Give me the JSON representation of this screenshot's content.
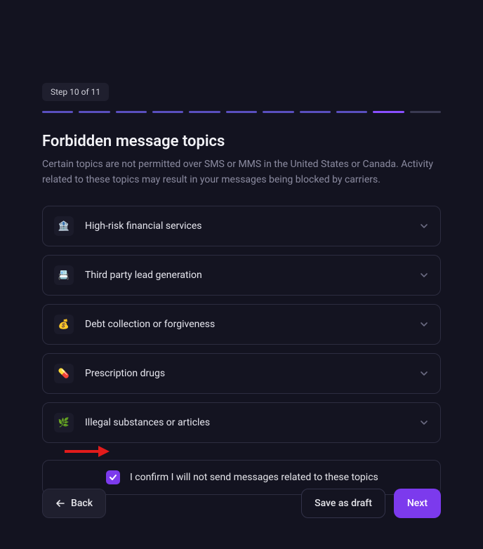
{
  "step": {
    "label": "Step 10 of 11",
    "segments": 11,
    "doneThrough": 9,
    "activeIndex": 10
  },
  "title": "Forbidden message topics",
  "subtitle": "Certain topics are not permitted over SMS or MMS in the United States or Canada. Activity related to these topics may result in your messages being blocked by carriers.",
  "topics": [
    {
      "icon": "🏦",
      "label": "High-risk financial services"
    },
    {
      "icon": "📇",
      "label": "Third party lead generation"
    },
    {
      "icon": "💰",
      "label": "Debt collection or forgiveness"
    },
    {
      "icon": "💊",
      "label": "Prescription drugs"
    },
    {
      "icon": "🌿",
      "label": "Illegal substances or articles"
    }
  ],
  "confirm": {
    "checked": true,
    "label": "I confirm I will not send messages related to these topics"
  },
  "footer": {
    "back": "Back",
    "saveDraft": "Save as draft",
    "next": "Next"
  }
}
